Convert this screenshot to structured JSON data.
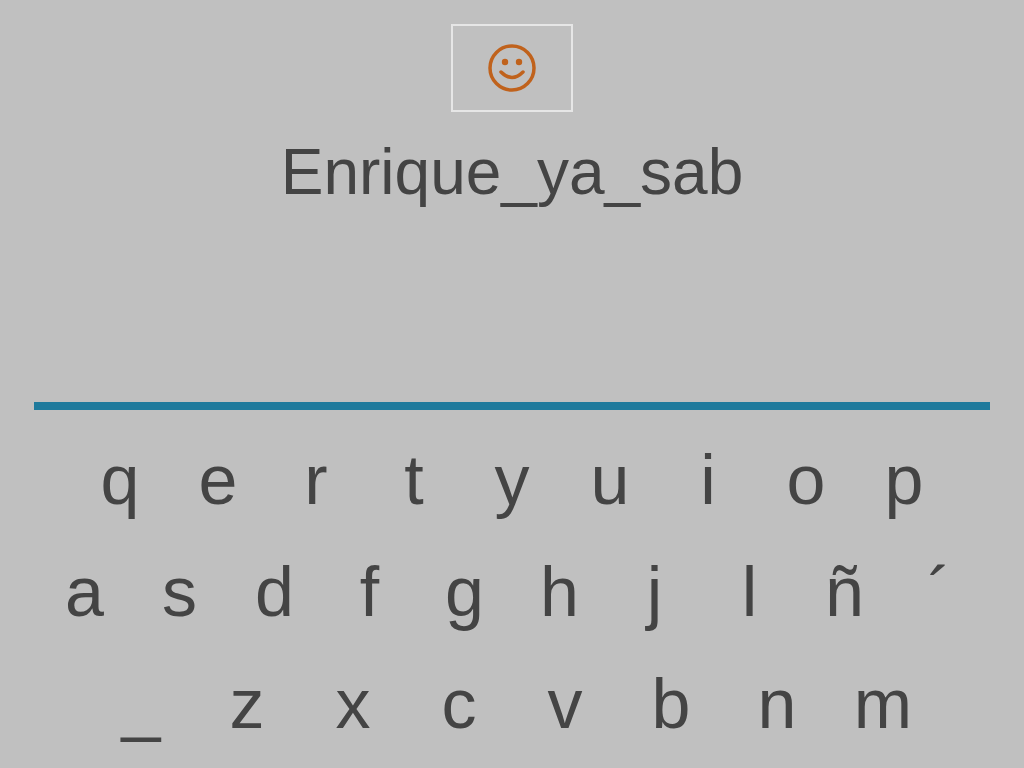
{
  "answer": "Enrique_ya_sab",
  "keyboard": {
    "rows": [
      [
        "q",
        "e",
        "r",
        "t",
        "y",
        "u",
        "i",
        "o",
        "p"
      ],
      [
        "a",
        "s",
        "d",
        "f",
        "g",
        "h",
        "j",
        "l",
        "ñ",
        "´"
      ],
      [
        "_",
        "z",
        "x",
        "c",
        "v",
        "b",
        "n",
        "m"
      ]
    ]
  }
}
